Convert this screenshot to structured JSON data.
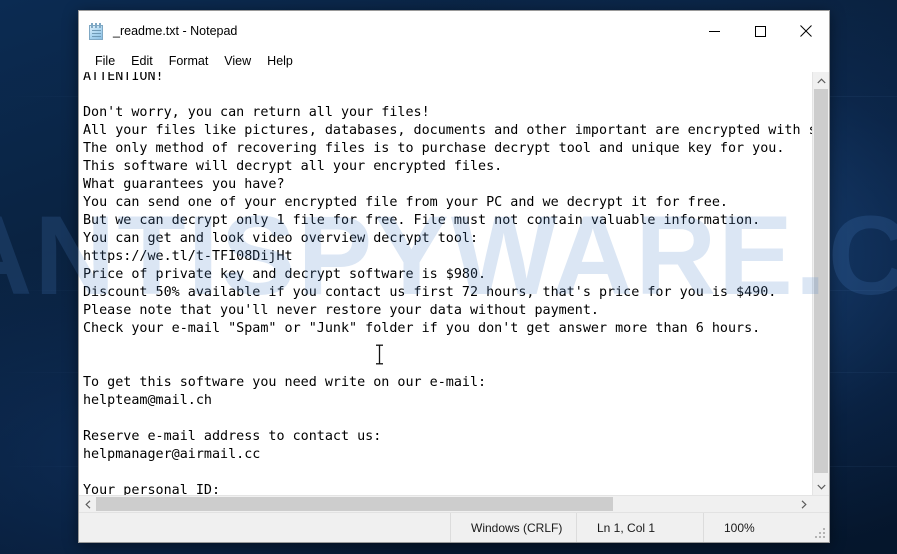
{
  "window": {
    "title": "_readme.txt - Notepad",
    "icon": "notepad-icon",
    "controls": {
      "minimize": "Minimize",
      "maximize": "Maximize",
      "close": "Close"
    }
  },
  "menu": {
    "items": [
      {
        "label": "File"
      },
      {
        "label": "Edit"
      },
      {
        "label": "Format"
      },
      {
        "label": "View"
      },
      {
        "label": "Help"
      }
    ]
  },
  "document": {
    "filename": "_readme.txt",
    "body": "ATTENTION!\n\nDon't worry, you can return all your files!\nAll your files like pictures, databases, documents and other important are encrypted with s\nThe only method of recovering files is to purchase decrypt tool and unique key for you.\nThis software will decrypt all your encrypted files.\nWhat guarantees you have?\nYou can send one of your encrypted file from your PC and we decrypt it for free.\nBut we can decrypt only 1 file for free. File must not contain valuable information.\nYou can get and look video overview decrypt tool:\nhttps://we.tl/t-TFI08DijHt\nPrice of private key and decrypt software is $980.\nDiscount 50% available if you contact us first 72 hours, that's price for you is $490.\nPlease note that you'll never restore your data without payment.\nCheck your e-mail \"Spam\" or \"Junk\" folder if you don't get answer more than 6 hours.\n\n\nTo get this software you need write on our e-mail:\nhelpteam@mail.ch\n\nReserve e-mail address to contact us:\nhelpmanager@airmail.cc\n\nYour personal ID:",
    "ransom_details": {
      "price_full": "$980",
      "price_discounted": "$490",
      "discount": "50%",
      "discount_window": "72 hours",
      "response_time": "6 hours",
      "video_url": "https://we.tl/t-TFI08DijHt",
      "primary_email": "helpteam@mail.ch",
      "reserve_email": "helpmanager@airmail.cc"
    }
  },
  "status_bar": {
    "encoding": "Windows (CRLF)",
    "position": "Ln 1, Col 1",
    "zoom": "100%"
  },
  "watermark": {
    "text": "MYANTISPYWARE.COM"
  },
  "colors": {
    "desktop": "#0a2240",
    "window_bg": "#ffffff",
    "status_bg": "#f0f0f0",
    "scrollbar_thumb": "#cdcdcd",
    "watermark": "#4a80c8"
  }
}
